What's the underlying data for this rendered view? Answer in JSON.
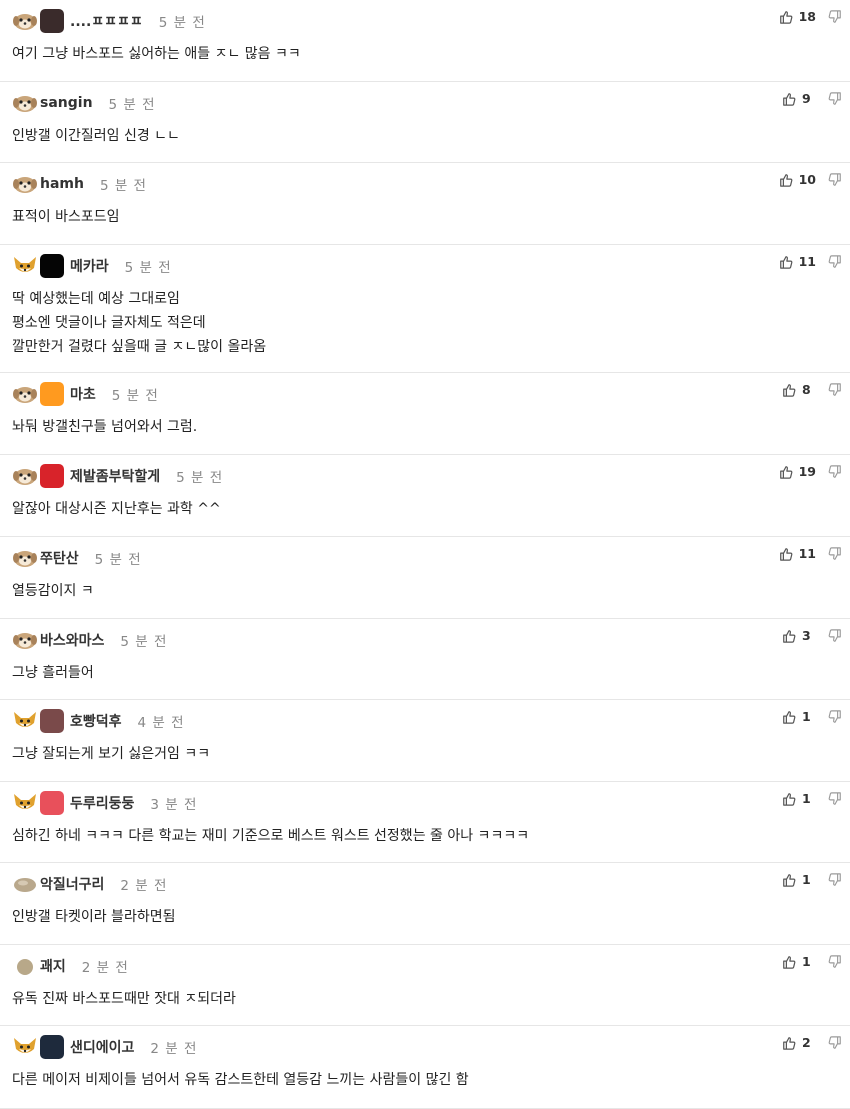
{
  "colors": {
    "text": "#222222",
    "muted": "#888888",
    "divider": "#e6e6e6",
    "level_dog": "#c9a57a",
    "level_fox": "#e0a12e"
  },
  "comments": [
    {
      "nickname": "....ㅍㅍㅍㅍ",
      "time": "5 분 전",
      "likes": "18",
      "lines": [
        "여기 그냥 바스포드 싫어하는 애들 ㅈㄴ 많음 ㅋㅋ"
      ],
      "level_icon": "dog-level-icon",
      "has_avatar": true,
      "avatar_color": "#3a2b2b"
    },
    {
      "nickname": "sangin",
      "time": "5 분 전",
      "likes": "9",
      "lines": [
        "인방갤 이간질러임 신경 ㄴㄴ"
      ],
      "level_icon": "dog-level-icon",
      "has_avatar": false
    },
    {
      "nickname": "hamh",
      "time": "5 분 전",
      "likes": "10",
      "lines": [
        "표적이 바스포드임"
      ],
      "level_icon": "dog-level-icon",
      "has_avatar": false
    },
    {
      "nickname": "메카라",
      "time": "5 분 전",
      "likes": "11",
      "lines": [
        "딱 예상했는데 예상 그대로임",
        "평소엔 댓글이나 글자체도 적은데",
        "깔만한거 걸렸다 싶을때 글 ㅈㄴ많이 올라옴"
      ],
      "level_icon": "fox-level-icon",
      "has_avatar": true,
      "avatar_color": "#050505"
    },
    {
      "nickname": "마초",
      "time": "5 분 전",
      "likes": "8",
      "lines": [
        "놔둬 방갤친구들 넘어와서 그럼."
      ],
      "level_icon": "dog-level-icon",
      "has_avatar": true,
      "avatar_color": "#ff9a1f"
    },
    {
      "nickname": "제발좀부탁할게",
      "time": "5 분 전",
      "likes": "19",
      "lines": [
        "알잖아 대상시즌 지난후는 과학 ^^"
      ],
      "level_icon": "dog-level-icon",
      "has_avatar": true,
      "avatar_color": "#d8232a"
    },
    {
      "nickname": "쭈탄산",
      "time": "5 분 전",
      "likes": "11",
      "lines": [
        "열등감이지 ㅋ"
      ],
      "level_icon": "dog-level-icon",
      "has_avatar": false
    },
    {
      "nickname": "바스와마스",
      "time": "5 분 전",
      "likes": "3",
      "lines": [
        "그냥 흘러들어"
      ],
      "level_icon": "dog-level-icon",
      "has_avatar": false
    },
    {
      "nickname": "호빵덕후",
      "time": "4 분 전",
      "likes": "1",
      "lines": [
        "그냥 잘되는게 보기 싫은거임 ㅋㅋ"
      ],
      "level_icon": "fox-level-icon",
      "has_avatar": true,
      "avatar_color": "#7a4a4a"
    },
    {
      "nickname": "두루리둥둥",
      "time": "3 분 전",
      "likes": "1",
      "lines": [
        "심하긴 하네 ㅋㅋㅋ 다른 학교는 재미 기준으로 베스트 워스트 선정했는 줄 아나 ㅋㅋㅋㅋ"
      ],
      "level_icon": "fox-level-icon",
      "has_avatar": true,
      "avatar_color": "#e8505b"
    },
    {
      "nickname": "악질너구리",
      "time": "2 분 전",
      "likes": "1",
      "lines": [
        "인방갤 타켓이라 블라하면됨"
      ],
      "level_icon": "egg-level-icon",
      "has_avatar": false
    },
    {
      "nickname": "괘지",
      "time": "2 분 전",
      "likes": "1",
      "lines": [
        "유독 진짜 바스포드때만 잣대 ㅈ되더라"
      ],
      "level_icon": "dot-level-icon",
      "has_avatar": false
    },
    {
      "nickname": "샌디에이고",
      "time": "2 분 전",
      "likes": "2",
      "lines": [
        "다른 메이저 비제이들 넘어서 유독 감스트한테 열등감 느끼는 사람들이 많긴 함"
      ],
      "level_icon": "fox-level-icon",
      "has_avatar": true,
      "avatar_color": "#1e2a3c"
    }
  ]
}
